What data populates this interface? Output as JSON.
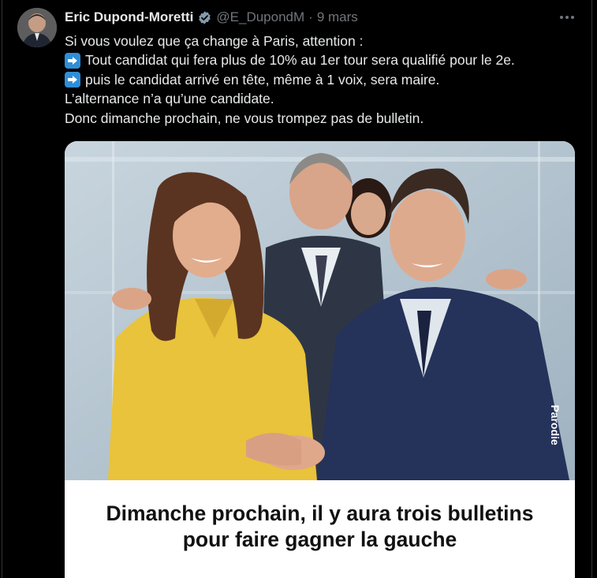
{
  "tweet": {
    "author": {
      "name": "Eric Dupond-Moretti",
      "handle": "@E_DupondM",
      "avatar_icon": "profile-photo",
      "verified_icon": "verified-badge-icon"
    },
    "separator": "·",
    "date": "9 mars",
    "more_icon": "more-horizontal-icon",
    "text": {
      "line1": "Si vous voulez que ça change à Paris, attention :",
      "line2": "Tout candidat qui fera plus de 10% au 1er tour sera qualifié pour le 2e.",
      "line3": "puis le candidat arrivé en tête, même à 1 voix, sera maire.",
      "line4": "L’alternance n’a qu’une candidate.",
      "line5": "Donc dimanche prochain, ne vous trompez pas de bulletin.",
      "bullet_icon": "right-arrow-emoji"
    },
    "media": {
      "watermark": "Parodie",
      "caption_line1": "Dimanche prochain, il y aura trois bulletins",
      "caption_line2": "pour faire gagner la gauche"
    }
  },
  "colors": {
    "background": "#000000",
    "text": "#e7e9ea",
    "secondary_text": "#71767b",
    "verified_badge": "#829aab",
    "emoji_blue": "#2f8ed8"
  }
}
